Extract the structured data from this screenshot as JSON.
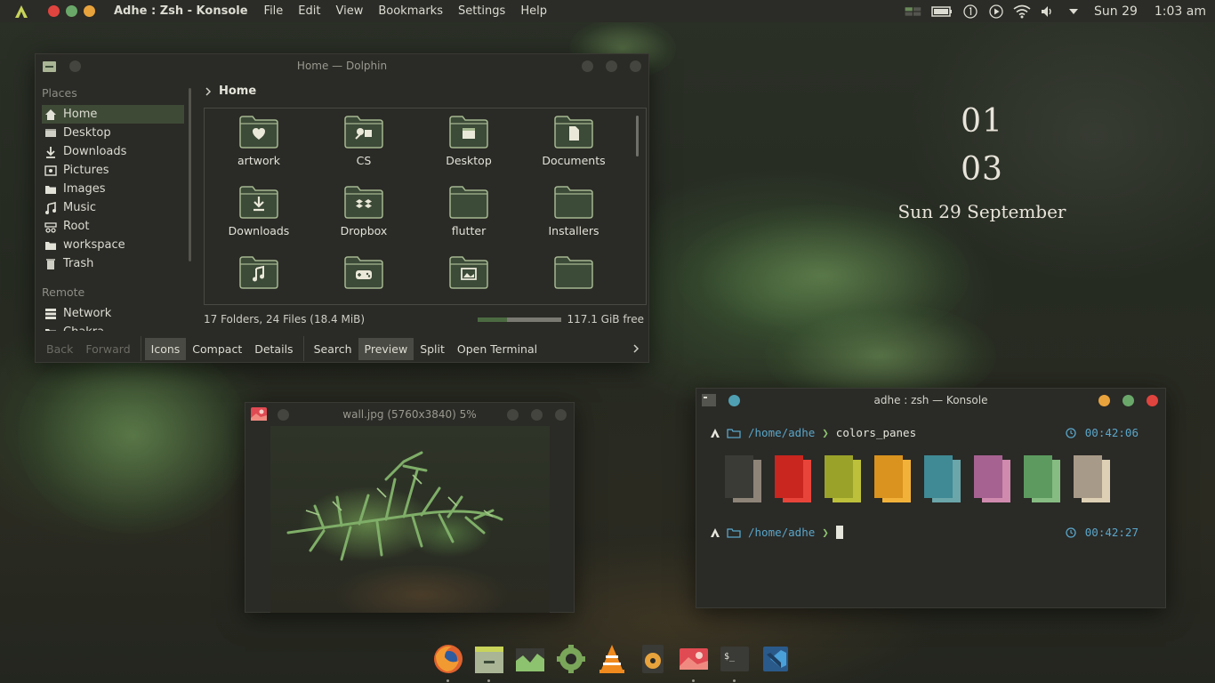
{
  "topbar": {
    "app_title": "Adhe : Zsh - Konsole",
    "menus": [
      "File",
      "Edit",
      "View",
      "Bookmarks",
      "Settings",
      "Help"
    ],
    "window_dots": [
      "#e0443e",
      "#6aa86a",
      "#e8a33c"
    ],
    "tray": {
      "date": "Sun 29",
      "time": "1:03 am",
      "icons": [
        "pager-icon",
        "battery-icon",
        "notifications-icon",
        "media-play-icon",
        "wifi-icon",
        "volume-icon",
        "arrow-down-icon"
      ]
    }
  },
  "clock": {
    "hour": "01",
    "minute": "03",
    "date": "Sun 29 September"
  },
  "dolphin": {
    "title": "Home — Dolphin",
    "places_heading": "Places",
    "places": [
      {
        "label": "Home",
        "icon": "home-icon",
        "active": true
      },
      {
        "label": "Desktop",
        "icon": "desktop-icon"
      },
      {
        "label": "Downloads",
        "icon": "download-icon"
      },
      {
        "label": "Pictures",
        "icon": "pictures-icon"
      },
      {
        "label": "Images",
        "icon": "folder-icon"
      },
      {
        "label": "Music",
        "icon": "music-icon"
      },
      {
        "label": "Root",
        "icon": "root-icon"
      },
      {
        "label": "workspace",
        "icon": "folder-icon"
      },
      {
        "label": "Trash",
        "icon": "trash-icon"
      }
    ],
    "remote_heading": "Remote",
    "remote": [
      {
        "label": "Network",
        "icon": "network-icon"
      },
      {
        "label": "Chakra",
        "icon": "folder-icon"
      }
    ],
    "breadcrumb": "Home",
    "files": [
      {
        "name": "artwork",
        "icon": "heart-folder-icon"
      },
      {
        "name": "CS",
        "icon": "tools-folder-icon"
      },
      {
        "name": "Desktop",
        "icon": "desktop-folder-icon"
      },
      {
        "name": "Documents",
        "icon": "document-folder-icon"
      },
      {
        "name": "Downloads",
        "icon": "download-folder-icon"
      },
      {
        "name": "Dropbox",
        "icon": "dropbox-folder-icon"
      },
      {
        "name": "flutter",
        "icon": "folder-icon"
      },
      {
        "name": "Installers",
        "icon": "folder-icon"
      },
      {
        "name": "",
        "icon": "music-folder-icon"
      },
      {
        "name": "",
        "icon": "games-folder-icon"
      },
      {
        "name": "",
        "icon": "pictures-folder-icon"
      },
      {
        "name": "",
        "icon": "folder-icon"
      }
    ],
    "status": "17 Folders, 24 Files (18.4 MiB)",
    "free_space": "117.1 GiB free",
    "used_fraction": 0.35,
    "toolbar": {
      "back": "Back",
      "forward": "Forward",
      "icons": "Icons",
      "compact": "Compact",
      "details": "Details",
      "search": "Search",
      "preview": "Preview",
      "split": "Split",
      "open_terminal": "Open Terminal"
    }
  },
  "viewer": {
    "title": "wall.jpg (5760x3840) 5%"
  },
  "konsole": {
    "title": "adhe : zsh — Konsole",
    "line1": {
      "path": "/home/adhe",
      "arrow": "❯",
      "command": "colors_panes",
      "time": "00:42:06"
    },
    "line2": {
      "path": "/home/adhe",
      "arrow": "❯",
      "time": "00:42:27"
    },
    "panes": [
      {
        "dark": "#3a3a36",
        "light": "#8e8478"
      },
      {
        "dark": "#c8261f",
        "light": "#e8443a"
      },
      {
        "dark": "#9aa22a",
        "light": "#bcc03a"
      },
      {
        "dark": "#d9931e",
        "light": "#f2b23a"
      },
      {
        "dark": "#3f8a94",
        "light": "#6aa6aa"
      },
      {
        "dark": "#a66290",
        "light": "#d08aae"
      },
      {
        "dark": "#5c9a60",
        "light": "#86bc82"
      },
      {
        "dark": "#a89a88",
        "light": "#ddd0b4"
      }
    ],
    "title_dots": [
      "#e8a33c",
      "#6aa86a",
      "#e0443e"
    ]
  },
  "dock": [
    "firefox-icon",
    "files-icon",
    "system-monitor-icon",
    "settings-icon",
    "vlc-icon",
    "music-player-icon",
    "image-viewer-icon",
    "terminal-icon",
    "vscode-icon"
  ],
  "colors": {
    "accent": "#3e4a36",
    "folder": "#3c4a38",
    "folder_stroke": "#a5b890"
  }
}
